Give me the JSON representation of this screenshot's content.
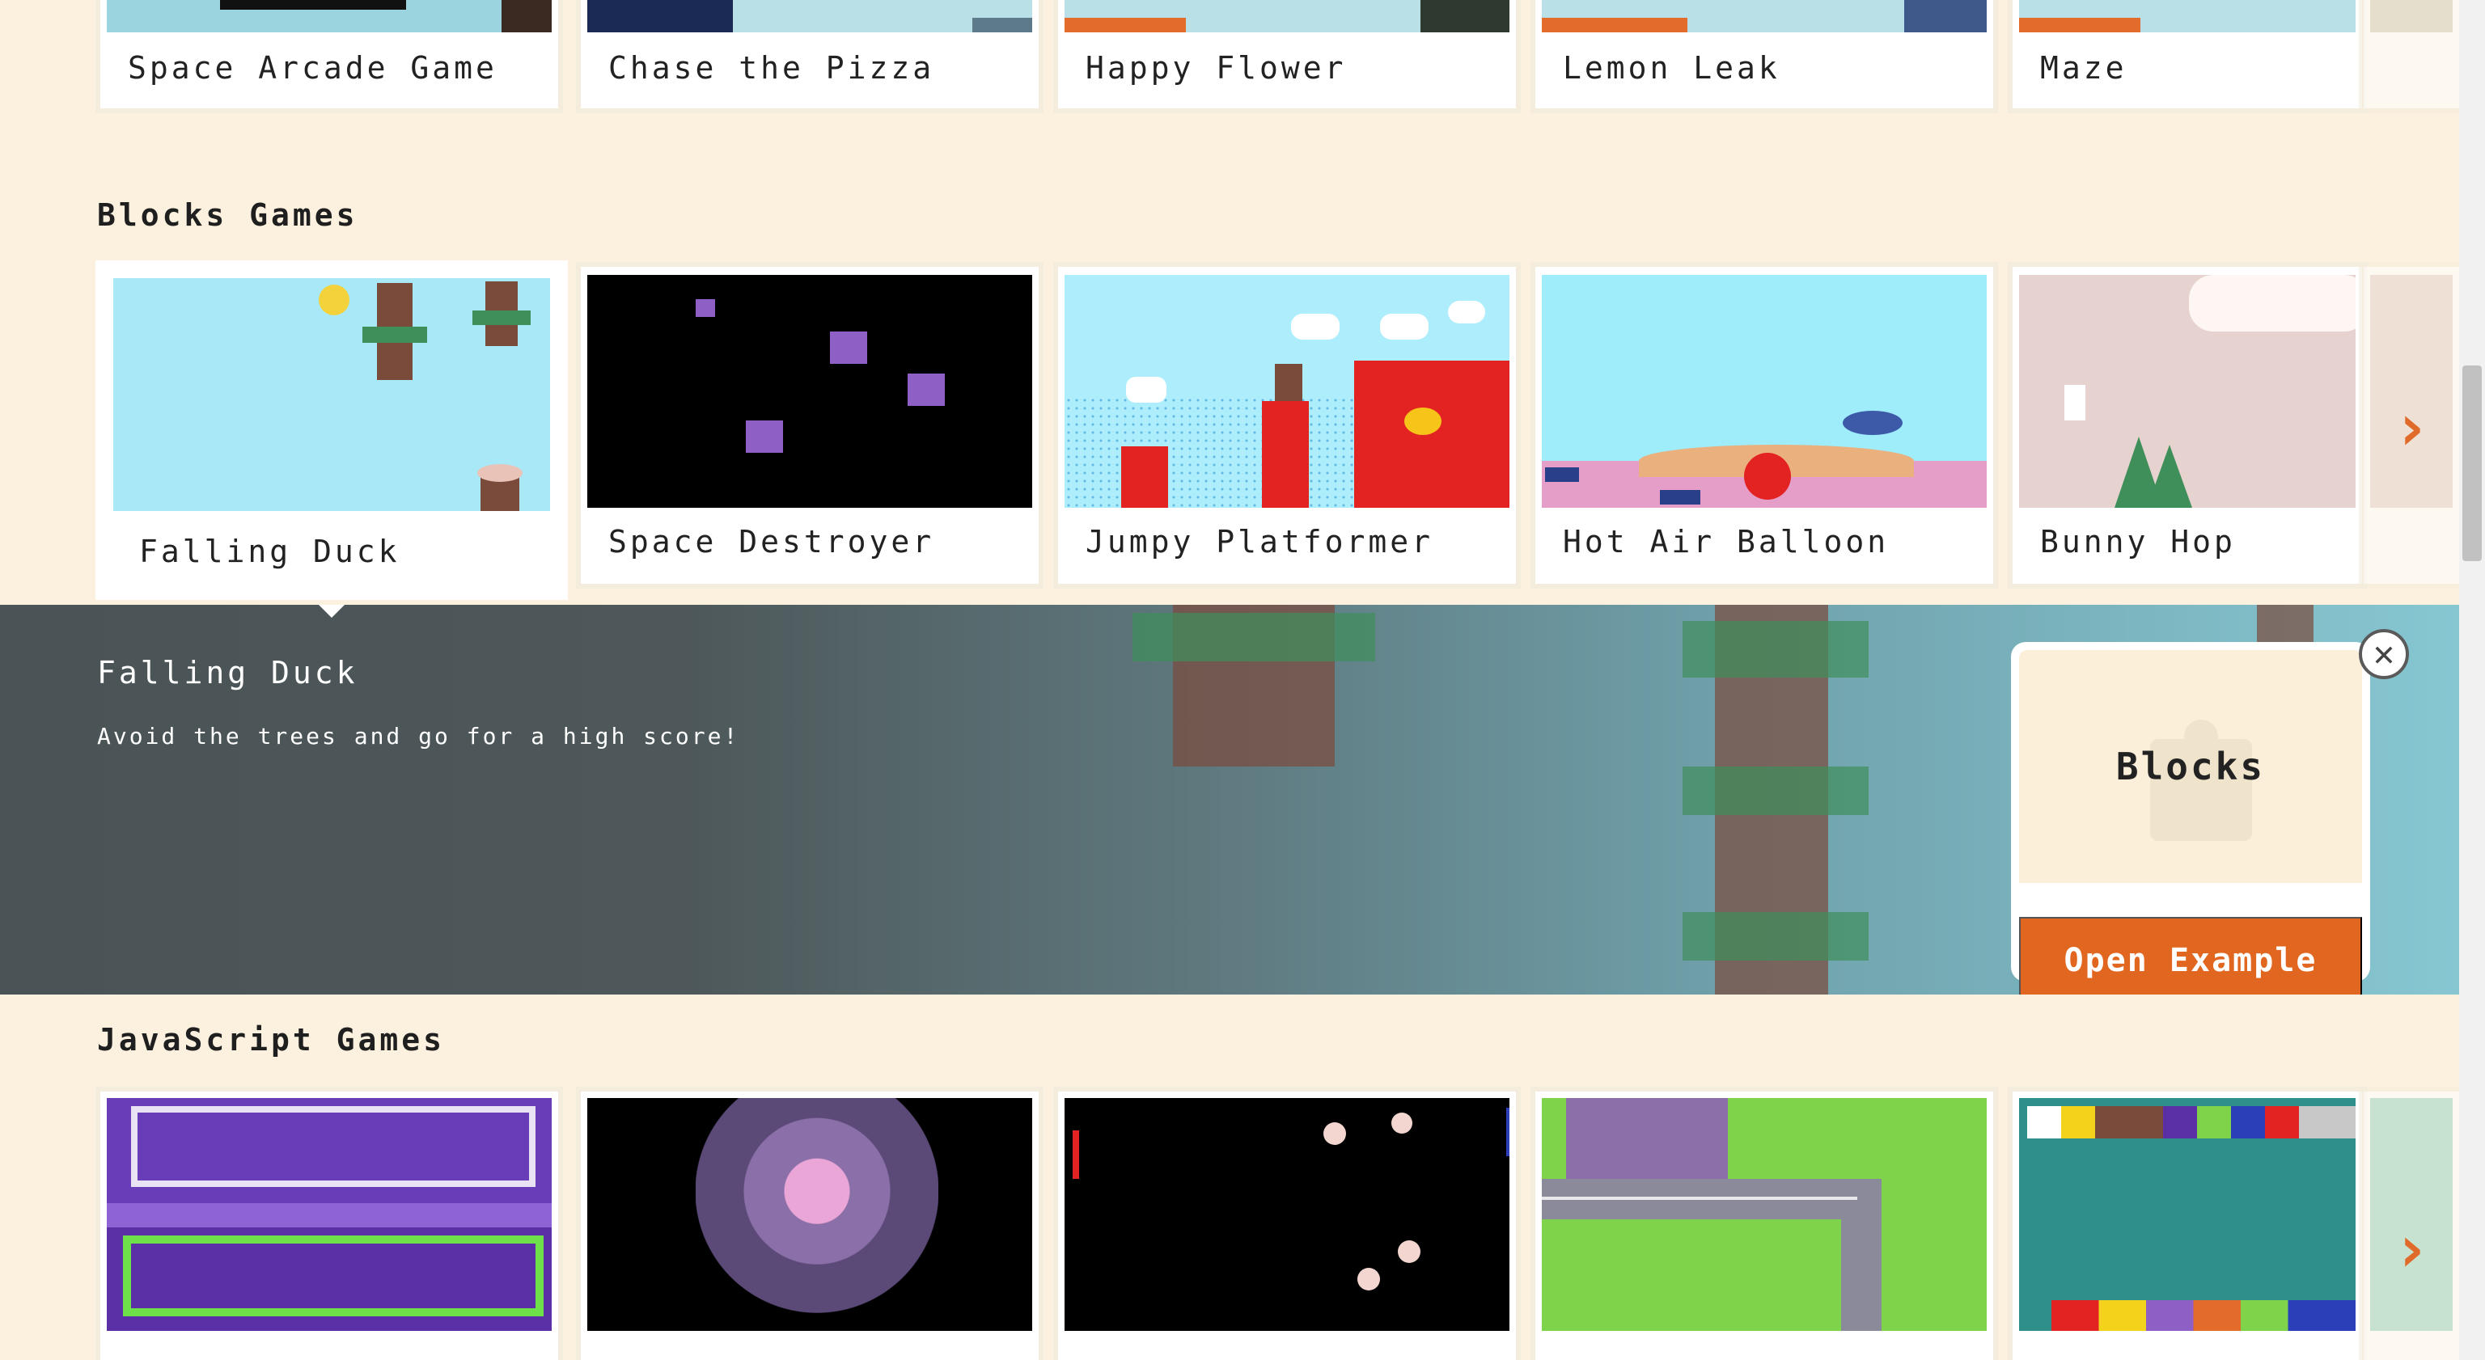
{
  "top_row": {
    "games": [
      {
        "label": "Space Arcade Game"
      },
      {
        "label": "Chase the Pizza"
      },
      {
        "label": "Happy Flower"
      },
      {
        "label": "Lemon Leak"
      },
      {
        "label": "Maze"
      }
    ]
  },
  "blocks_section": {
    "title": "Blocks Games",
    "games": [
      {
        "label": "Falling Duck"
      },
      {
        "label": "Space Destroyer"
      },
      {
        "label": "Jumpy Platformer"
      },
      {
        "label": "Hot Air Balloon"
      },
      {
        "label": "Bunny Hop"
      }
    ],
    "next_arrow": "›"
  },
  "detail": {
    "title": "Falling Duck",
    "description": "Avoid the trees and go for a high score!",
    "editor_name": "Blocks",
    "open_button": "Open Example",
    "close_symbol": "✕"
  },
  "javascript_section": {
    "title": "JavaScript Games",
    "next_arrow": "›"
  },
  "colors": {
    "background": "#fcf1de",
    "accent": "#e1661f",
    "panel": "#4e585a"
  }
}
